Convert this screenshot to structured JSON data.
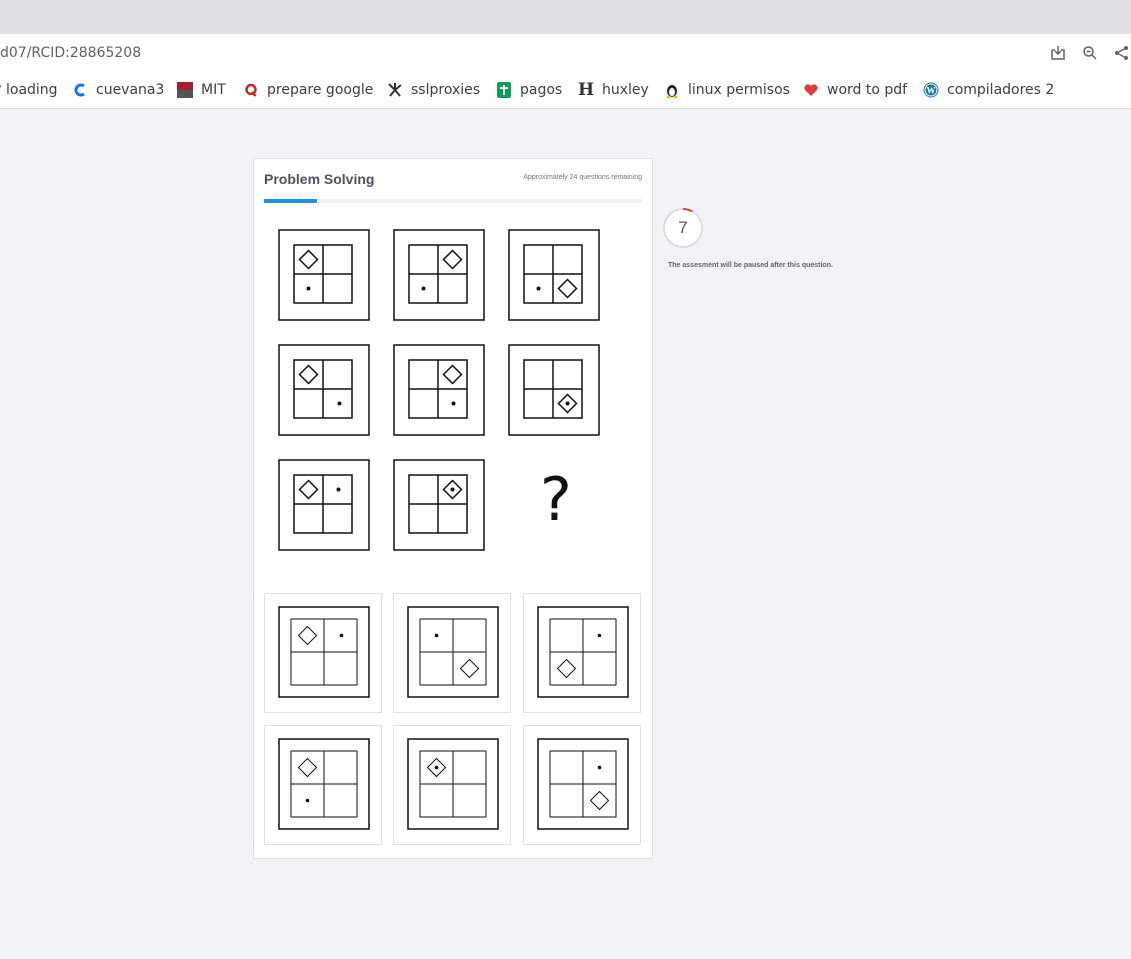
{
  "browser": {
    "url": "d07/RCID:28865208",
    "icons": [
      "install-icon",
      "zoom-icon",
      "share-icon"
    ],
    "bookmarks": [
      {
        "label": "loading",
        "icon": "loading-icon",
        "color": "#5f6368"
      },
      {
        "label": "cuevana3",
        "icon": "cuevana-icon",
        "color": "#1a73e8"
      },
      {
        "label": "MIT",
        "icon": "mit-ocw-icon",
        "color": "#a31f34"
      },
      {
        "label": "prepare google",
        "icon": "quora-icon",
        "color": "#b92b27"
      },
      {
        "label": "sslproxies",
        "icon": "sslproxies-icon",
        "color": "#333333"
      },
      {
        "label": "pagos",
        "icon": "sheets-icon",
        "color": "#0f9d58"
      },
      {
        "label": "huxley",
        "icon": "huxley-icon",
        "color": "#333333"
      },
      {
        "label": "linux permisos",
        "icon": "linux-icon",
        "color": "#222222"
      },
      {
        "label": "word to pdf",
        "icon": "heart-icon",
        "color": "#e0393e"
      },
      {
        "label": "compiladores 2",
        "icon": "wordpress-icon",
        "color": "#21759b"
      }
    ]
  },
  "assessment": {
    "title": "Problem Solving",
    "remaining": "Approximately 24 questions remaining",
    "progress_fraction": 0.14,
    "question_mark": "?",
    "timer_value": "7",
    "timer_fraction_remaining": 0.08,
    "pause_note": "The assesment will be paused after this question.",
    "accent_color": "#2491d8",
    "timer_color": "#e53935"
  }
}
